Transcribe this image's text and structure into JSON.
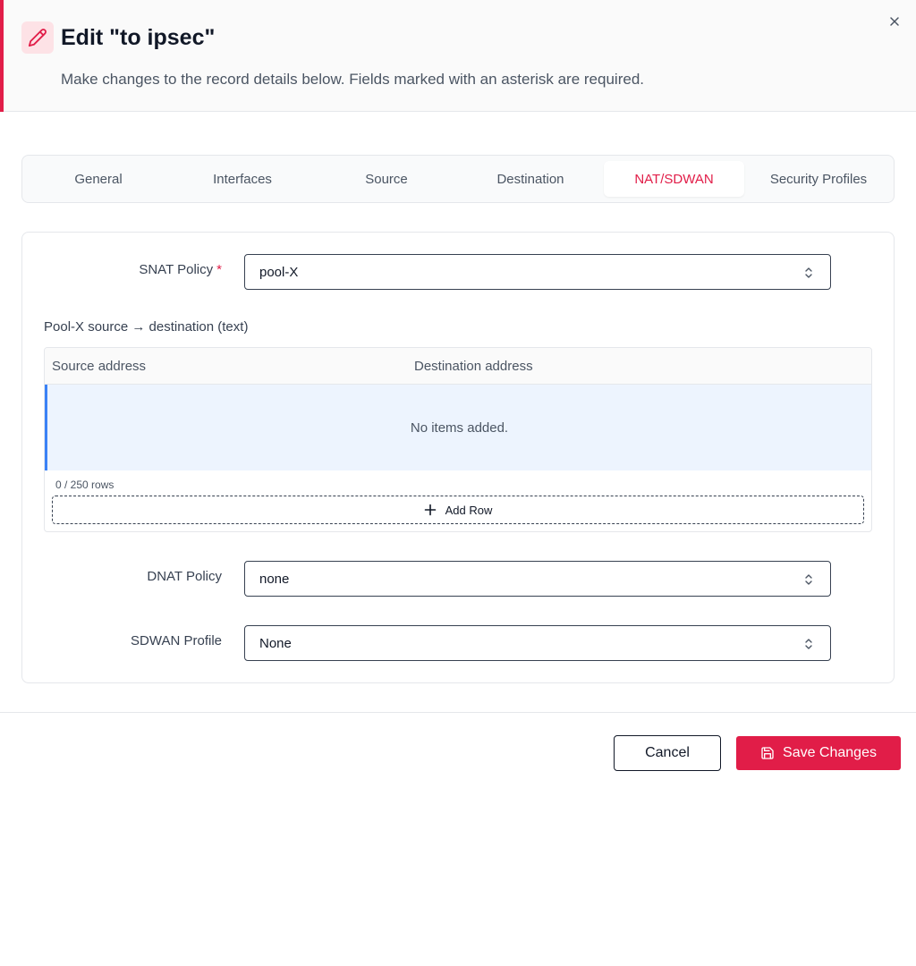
{
  "dialog": {
    "title": "Edit \"to ipsec\"",
    "subtitle": "Make changes to the record details below. Fields marked with an asterisk are required.",
    "icon": "pencil-icon",
    "close_icon": "close-icon",
    "accent_color": "#e11d48"
  },
  "tabs": [
    {
      "label": "General",
      "active": false
    },
    {
      "label": "Interfaces",
      "active": false
    },
    {
      "label": "Source",
      "active": false
    },
    {
      "label": "Destination",
      "active": false
    },
    {
      "label": "NAT/SDWAN",
      "active": true
    },
    {
      "label": "Security Profiles",
      "active": false
    }
  ],
  "snat": {
    "label": "SNAT Policy",
    "required_mark": "*",
    "value": "pool-X"
  },
  "pool_table": {
    "title": "Pool-X source → destination (text)",
    "columns": [
      "Source address",
      "Destination address"
    ],
    "empty_text": "No items added.",
    "rows_count": "0 / 250 rows",
    "add_row_label": "Add Row"
  },
  "dnat": {
    "label": "DNAT Policy",
    "value": "none"
  },
  "sdwan": {
    "label": "SDWAN Profile",
    "value": "None"
  },
  "footer": {
    "cancel_label": "Cancel",
    "save_label": "Save Changes"
  }
}
